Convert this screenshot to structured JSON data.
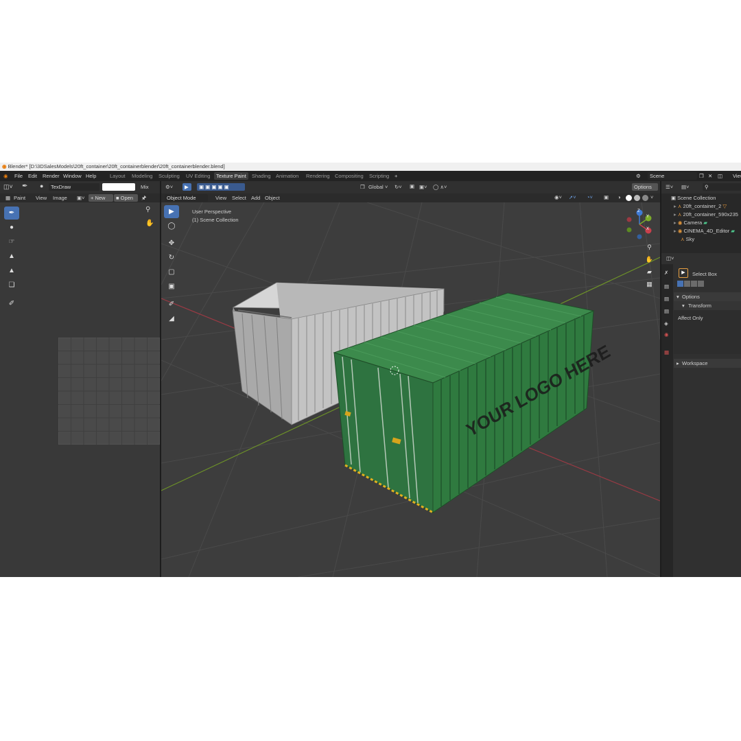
{
  "window": {
    "title": "Blender* [D:\\3DSalesModels\\20ft_container\\20ft_containerblender\\20ft_containerblender.blend]"
  },
  "menu": [
    "File",
    "Edit",
    "Render",
    "Window",
    "Help"
  ],
  "workspaces": [
    {
      "label": "Layout",
      "active": false
    },
    {
      "label": "Modeling",
      "active": false
    },
    {
      "label": "Sculpting",
      "active": false
    },
    {
      "label": "UV Editing",
      "active": false
    },
    {
      "label": "Texture Paint",
      "active": true
    },
    {
      "label": "Shading",
      "active": false
    },
    {
      "label": "Animation",
      "active": false
    },
    {
      "label": "Rendering",
      "active": false
    },
    {
      "label": "Compositing",
      "active": false
    },
    {
      "label": "Scripting",
      "active": false
    }
  ],
  "add_workspace": "+",
  "scene": {
    "name": "Scene",
    "view_layer": "View"
  },
  "image_editor": {
    "brush": "TexDraw",
    "blend": "Mix",
    "mode": "Paint",
    "view": "View",
    "image": "Image",
    "new": "New",
    "open": "Open"
  },
  "viewport": {
    "mode": "Object Mode",
    "menus": [
      "View",
      "Select",
      "Add",
      "Object"
    ],
    "transform_orientation": "Global",
    "options": "Options",
    "overlay_line1": "User Perspective",
    "overlay_line2": "(1) Scene Collection",
    "container_text": "YOUR LOGO HERE",
    "axis_labels": {
      "x": "X",
      "y": "Y",
      "z": "Z"
    }
  },
  "outliner": {
    "root": "Scene Collection",
    "items": [
      {
        "label": "20ft_container_2",
        "icon": "object-icon"
      },
      {
        "label": "20ft_container_590x235",
        "icon": "object-icon"
      },
      {
        "label": "Camera",
        "icon": "camera-icon"
      },
      {
        "label": "CINEMA_4D_Editor",
        "icon": "camera-icon"
      },
      {
        "label": "Sky",
        "icon": "light-icon"
      }
    ]
  },
  "properties": {
    "tool": "Select Box",
    "options": "Options",
    "transform": "Transform",
    "affect_only": "Affect Only",
    "workspace": "Workspace"
  },
  "colors": {
    "accent": "#4772b3",
    "container_green": "#2f7a3f",
    "container_white": "#c8c8c8",
    "axis_x": "#c9404c",
    "axis_y": "#7cab2a",
    "axis_z": "#3f7bd6"
  }
}
